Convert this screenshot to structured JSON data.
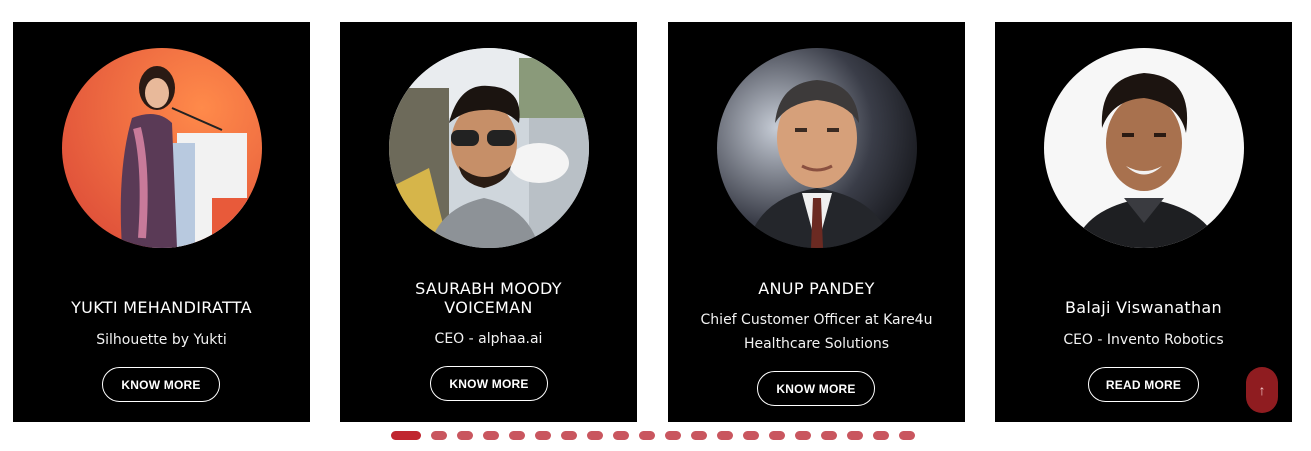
{
  "speakers": [
    {
      "name_lines": [
        "YUKTI MEHANDIRATTA"
      ],
      "role_lines": [
        "Silhouette by Yukti"
      ],
      "button": "KNOW MORE"
    },
    {
      "name_lines": [
        "SAURABH MOODY",
        "VOICEMAN"
      ],
      "role_lines": [
        "CEO - alphaa.ai"
      ],
      "button": "KNOW MORE"
    },
    {
      "name_lines": [
        "ANUP PANDEY"
      ],
      "role_lines": [
        "Chief Customer Officer at Kare4u",
        "Healthcare Solutions"
      ],
      "button": "KNOW MORE"
    },
    {
      "name_lines": [
        "Balaji Viswanathan"
      ],
      "role_lines": [
        "CEO - Invento Robotics"
      ],
      "button": "READ MORE"
    }
  ],
  "carousel": {
    "dot_count": 20,
    "active_index": 0
  },
  "scroll_top": {
    "icon": "arrow-up-icon",
    "glyph": "↑"
  },
  "colors": {
    "card_bg": "#000000",
    "accent": "#c0262f",
    "dot": "#c9565f",
    "top_button": "#8f1c20"
  }
}
